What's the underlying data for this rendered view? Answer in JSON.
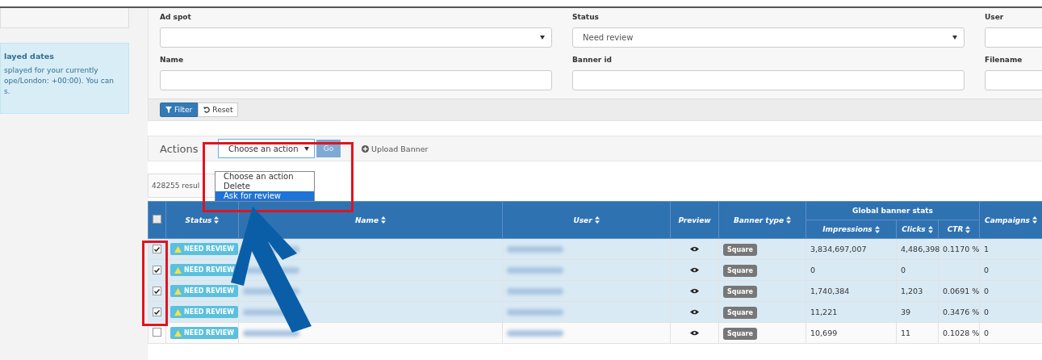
{
  "sidebar": {
    "info_title": "layed dates",
    "info_lines": [
      "splayed for your currently",
      "ope/London: +00:00). You can",
      "s."
    ]
  },
  "filters": {
    "fields": [
      {
        "label": "Ad spot",
        "kind": "select"
      },
      {
        "label": "Status",
        "kind": "select",
        "value": "Need review"
      },
      {
        "label": "User",
        "kind": "text"
      },
      {
        "label": "Name",
        "kind": "text"
      },
      {
        "label": "Banner id",
        "kind": "text"
      },
      {
        "label": "Filename",
        "kind": "text"
      }
    ],
    "filter_button": "Filter",
    "reset_button": "Reset"
  },
  "actions": {
    "label": "Actions",
    "select": "Choose an action",
    "options": [
      {
        "label": "Choose an action",
        "selected": false
      },
      {
        "label": "Delete",
        "selected": false
      },
      {
        "label": "Ask for review",
        "selected": true
      }
    ],
    "go": "Go",
    "upload": "Upload Banner"
  },
  "results": "428255 resul",
  "table": {
    "select_all_checked": false,
    "columns": [
      "Status",
      "Name",
      "User",
      "Preview",
      "Banner type"
    ],
    "group": "Global banner stats",
    "stat_columns": [
      "Impressions",
      "Clicks",
      "CTR"
    ],
    "last_column": "Campaigns",
    "rows": [
      {
        "checked": true,
        "status": "NEED REVIEW",
        "banner_type": "Square",
        "impressions": "3,834,697,007",
        "clicks": "4,486,398",
        "ctr": "0.1170 %",
        "campaigns": "1"
      },
      {
        "checked": true,
        "status": "NEED REVIEW",
        "banner_type": "Square",
        "impressions": "0",
        "clicks": "0",
        "ctr": "",
        "campaigns": "0"
      },
      {
        "checked": true,
        "status": "NEED REVIEW",
        "banner_type": "Square",
        "impressions": "1,740,384",
        "clicks": "1,203",
        "ctr": "0.0691 %",
        "campaigns": "0"
      },
      {
        "checked": true,
        "status": "NEED REVIEW",
        "banner_type": "Square",
        "impressions": "11,221",
        "clicks": "39",
        "ctr": "0.3476 %",
        "campaigns": "0"
      },
      {
        "checked": false,
        "status": "NEED REVIEW",
        "banner_type": "Square",
        "impressions": "10,699",
        "clicks": "11",
        "ctr": "0.1028 %",
        "campaigns": "0"
      }
    ]
  }
}
